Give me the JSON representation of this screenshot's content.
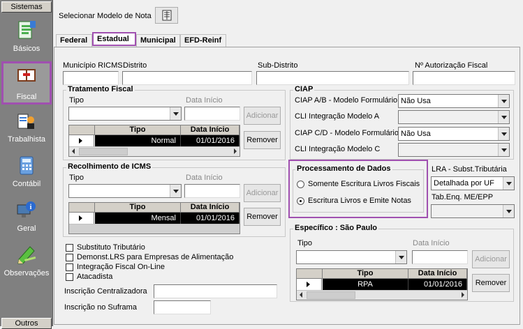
{
  "sidebar": {
    "header_top": "Sistemas",
    "header_bottom": "Outros",
    "items": [
      {
        "label": "Básicos",
        "icon": "document-icon"
      },
      {
        "label": "Fiscal",
        "icon": "book-icon"
      },
      {
        "label": "Trabalhista",
        "icon": "worker-icon"
      },
      {
        "label": "Contábil",
        "icon": "calculator-icon"
      },
      {
        "label": "Geral",
        "icon": "info-computer-icon"
      },
      {
        "label": "Observações",
        "icon": "pencil-icon"
      }
    ]
  },
  "toolbar": {
    "model_label": "Selecionar Modelo de Nota"
  },
  "tabs": [
    "Federal",
    "Estadual",
    "Municipal",
    "EFD-Reinf"
  ],
  "top_fields": {
    "municipio": "Município RICMS",
    "distrito": "Distrito",
    "subdistrito": "Sub-Distrito",
    "autorizacao": "Nº Autorização Fiscal"
  },
  "tratamento": {
    "title": "Tratamento Fiscal",
    "tipo_label": "Tipo",
    "data_label": "Data Início",
    "add_btn": "Adicionar",
    "remove_btn": "Remover",
    "col_tipo": "Tipo",
    "col_data": "Data Início",
    "row_tipo": "Normal",
    "row_data": "01/01/2016"
  },
  "recolhimento": {
    "title": "Recolhimento de ICMS",
    "tipo_label": "Tipo",
    "data_label": "Data Início",
    "add_btn": "Adicionar",
    "remove_btn": "Remover",
    "col_tipo": "Tipo",
    "col_data": "Data Início",
    "row_tipo": "Mensal",
    "row_data": "01/01/2016"
  },
  "checks": [
    "Substituto Tributário",
    "Demonst.LRS para Empresas de Alimentação",
    "Integração Fiscal On-Line",
    "Atacadista"
  ],
  "inscricao_centralizadora": "Inscrição Centralizadora",
  "inscricao_suframa": "Inscrição no Suframa",
  "ciap": {
    "title": "CIAP",
    "ab_label": "CIAP  A/B - Modelo Formulário",
    "ab_value": "Não Usa",
    "cli_a_label": "CLI Integração Modelo A",
    "cd_label": "CIAP C/D - Modelo Formulário",
    "cd_value": "Não Usa",
    "cli_c_label": "CLI Integração Modelo C"
  },
  "processamento": {
    "title": "Processamento de Dados",
    "opt1": "Somente Escritura Livros Fiscais",
    "opt2": "Escritura Livros e Emite Notas"
  },
  "lra": {
    "label": "LRA - Subst.Tributária",
    "value": "Detalhada por UF",
    "tab_label": "Tab.Enq. ME/EPP"
  },
  "especifico": {
    "title": "Específico : São Paulo",
    "tipo_label": "Tipo",
    "data_label": "Data Início",
    "add_btn": "Adicionar",
    "remove_btn": "Remover",
    "col_tipo": "Tipo",
    "col_data": "Data Início",
    "row_tipo": "RPA",
    "row_data": "01/01/2016"
  },
  "colors": {
    "highlight": "#a050b0",
    "sidebar": "#808080"
  }
}
